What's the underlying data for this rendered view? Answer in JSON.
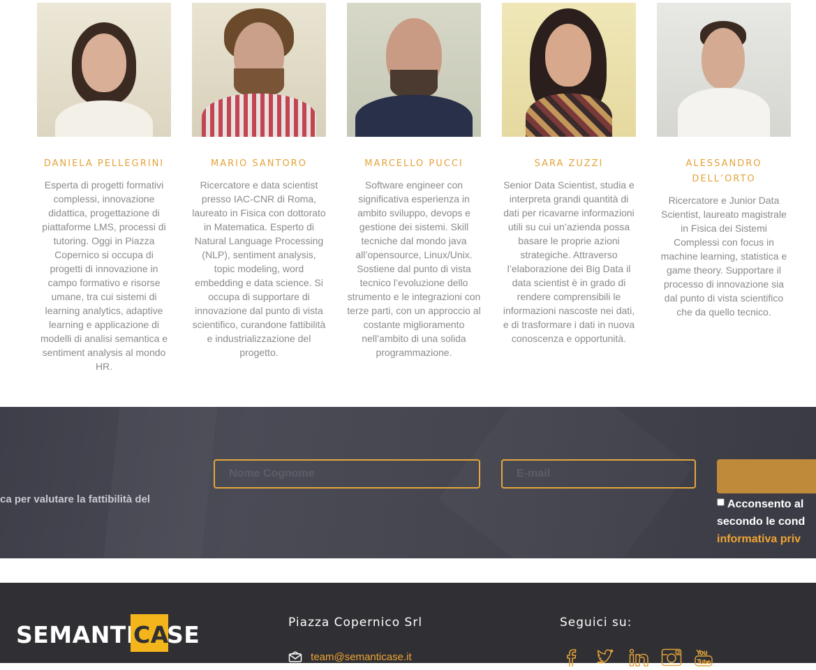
{
  "team": [
    {
      "name": "DANIELA PELLEGRINI",
      "bio": "Esperta di progetti formativi complessi, innovazione didattica, progettazione di piattaforme LMS, processi di tutoring. Oggi in Piazza Copernico si occupa di progetti di innovazione in campo formativo e risorse umane, tra cui sistemi di learning analytics, adaptive learning e applicazione di modelli di analisi semantica e sentiment analysis al mondo HR."
    },
    {
      "name": "MARIO SANTORO",
      "bio": "Ricercatore e data scientist presso IAC-CNR di Roma, laureato in Fisica con dottorato in Matematica. Esperto di Natural Language Processing (NLP), sentiment analysis, topic modeling, word embedding e data science. Si occupa di supportare di innovazione dal punto di vista scientifico, curandone fattibilità e industrializzazione del progetto."
    },
    {
      "name": "MARCELLO PUCCI",
      "bio": "Software engineer con significativa esperienza in ambito sviluppo, devops e gestione dei sistemi. Skill tecniche dal mondo java all’opensource, Linux/Unix. Sostiene dal punto di vista tecnico l’evoluzione dello strumento e le integrazioni con terze parti, con un approccio al costante miglioramento nell’ambito di una solida programmazione."
    },
    {
      "name": "SARA ZUZZI",
      "bio": "Senior Data Scientist, studia e interpreta grandi quantità di dati per ricavarne informazioni utili su cui un’azienda possa basare le proprie azioni strategiche. Attraverso l’elaborazione dei Big Data il data scientist è in grado di rendere comprensibili le informazioni nascoste nei dati, e di trasformare i dati in nuova conoscenza e opportunità."
    },
    {
      "name": "ALESSANDRO DELL’ORTO",
      "bio": "Ricercatore e Junior Data Scientist, laureato magistrale in Fisica dei Sistemi Complessi con focus in machine learning, statistica e game theory. Supportare il processo di innovazione sia dal punto di vista scientifico che da quello tecnico."
    }
  ],
  "contact_form": {
    "intro_text": "ca per valutare la fattibilità del",
    "name_placeholder": "Nome Cognome",
    "email_placeholder": "E-mail",
    "consent_line1": "Acconsento al",
    "consent_line2": "secondo le cond",
    "privacy_link": "informativa priv"
  },
  "footer": {
    "logo_text_a": "SEMANTI",
    "logo_text_b": "CA",
    "logo_text_c": "SE",
    "company": "Piazza Copernico Srl",
    "email": "team@semanticase.it",
    "follow_label": "Seguici su:",
    "social_icons": [
      "facebook-icon",
      "twitter-icon",
      "linkedin-icon",
      "instagram-icon",
      "youtube-icon"
    ]
  },
  "colors": {
    "accent": "#e3a33a",
    "band": "#45454f",
    "footer": "#2f2f34",
    "logo_yellow": "#f3b51b"
  }
}
